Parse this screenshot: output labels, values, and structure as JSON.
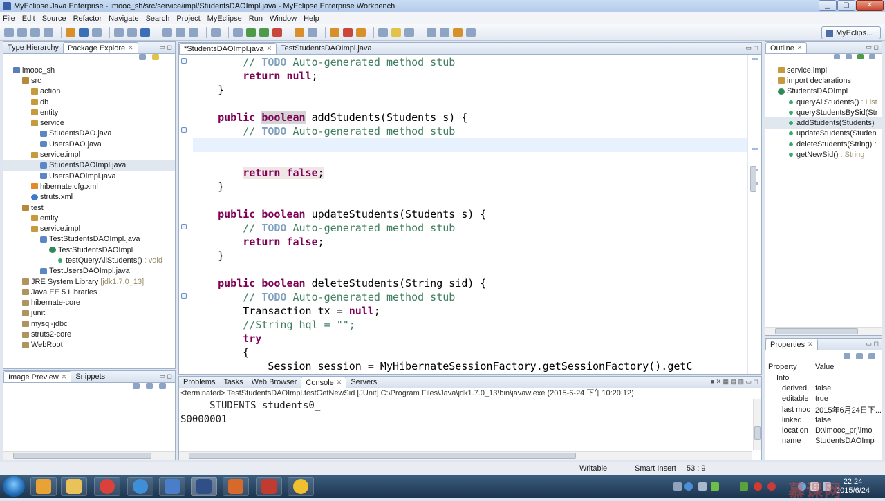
{
  "window": {
    "title": "MyEclipse Java Enterprise - imooc_sh/src/service/impl/StudentsDAOImpl.java - MyEclipse Enterprise Workbench"
  },
  "menu": [
    "File",
    "Edit",
    "Source",
    "Refactor",
    "Navigate",
    "Search",
    "Project",
    "MyEclipse",
    "Run",
    "Window",
    "Help"
  ],
  "perspective": "MyEclips...",
  "left_panel": {
    "tabs": [
      {
        "label": "Type Hierarchy"
      },
      {
        "label": "Package Explore"
      }
    ],
    "tree": [
      {
        "label": "imooc_sh",
        "icon": "project-icon",
        "depth": 0
      },
      {
        "label": "src",
        "icon": "source-folder-icon",
        "depth": 1
      },
      {
        "label": "action",
        "icon": "package-icon",
        "depth": 2
      },
      {
        "label": "db",
        "icon": "package-icon",
        "depth": 2
      },
      {
        "label": "entity",
        "icon": "package-icon",
        "depth": 2
      },
      {
        "label": "service",
        "icon": "package-icon",
        "depth": 2
      },
      {
        "label": "StudentsDAO.java",
        "icon": "java-file-icon",
        "depth": 3
      },
      {
        "label": "UsersDAO.java",
        "icon": "java-file-icon",
        "depth": 3
      },
      {
        "label": "service.impl",
        "icon": "package-icon",
        "depth": 2
      },
      {
        "label": "StudentsDAOImpl.java",
        "icon": "java-file-icon",
        "depth": 3,
        "selected": true
      },
      {
        "label": "UsersDAOImpl.java",
        "icon": "java-file-icon",
        "depth": 3
      },
      {
        "label": "hibernate.cfg.xml",
        "icon": "xml-file-icon",
        "depth": 2
      },
      {
        "label": "struts.xml",
        "icon": "config-icon",
        "depth": 2
      },
      {
        "label": "test",
        "icon": "source-folder-icon",
        "depth": 1
      },
      {
        "label": "entity",
        "icon": "package-icon",
        "depth": 2
      },
      {
        "label": "service.impl",
        "icon": "package-icon",
        "depth": 2
      },
      {
        "label": "TestStudentsDAOImpl.java",
        "icon": "java-file-icon",
        "depth": 3
      },
      {
        "label": "TestStudentsDAOImpl",
        "icon": "class-icon",
        "depth": 4
      },
      {
        "label": "testQueryAllStudents()",
        "sub": ": void",
        "icon": "method-icon",
        "depth": 5
      },
      {
        "label": "TestUsersDAOImpl.java",
        "icon": "java-file-icon",
        "depth": 3
      },
      {
        "label": "JRE System Library",
        "sub": "[jdk1.7.0_13]",
        "icon": "library-icon",
        "depth": 1
      },
      {
        "label": "Java EE 5 Libraries",
        "icon": "library-icon",
        "depth": 1
      },
      {
        "label": "hibernate-core",
        "icon": "library-icon",
        "depth": 1
      },
      {
        "label": "junit",
        "icon": "library-icon",
        "depth": 1
      },
      {
        "label": "mysql-jdbc",
        "icon": "library-icon",
        "depth": 1
      },
      {
        "label": "struts2-core",
        "icon": "library-icon",
        "depth": 1
      },
      {
        "label": "WebRoot",
        "icon": "folder-icon",
        "depth": 1
      }
    ]
  },
  "bottom_left": {
    "tabs": [
      {
        "label": "Image Preview"
      },
      {
        "label": "Snippets"
      }
    ]
  },
  "editor": {
    "tabs": [
      {
        "label": "*StudentsDAOImpl.java"
      },
      {
        "label": "TestStudentsDAOImpl.java"
      }
    ],
    "lines": [
      {
        "text": "        // TODO Auto-generated method stub",
        "type": "todo"
      },
      {
        "text": "        return null;",
        "type": "ret"
      },
      {
        "text": "    }",
        "type": "plain"
      },
      {
        "text": "",
        "type": "plain"
      },
      {
        "text": "    public boolean addStudents(Students s) {",
        "type": "sig"
      },
      {
        "text": "        // TODO Auto-generated method stub",
        "type": "todo"
      },
      {
        "text": "        ",
        "type": "cursor"
      },
      {
        "text": "",
        "type": "plain"
      },
      {
        "text": "        return false;",
        "type": "ret-hl"
      },
      {
        "text": "    }",
        "type": "plain"
      },
      {
        "text": "",
        "type": "plain"
      },
      {
        "text": "    public boolean updateStudents(Students s) {",
        "type": "sig"
      },
      {
        "text": "        // TODO Auto-generated method stub",
        "type": "todo"
      },
      {
        "text": "        return false;",
        "type": "ret"
      },
      {
        "text": "    }",
        "type": "plain"
      },
      {
        "text": "",
        "type": "plain"
      },
      {
        "text": "    public boolean deleteStudents(String sid) {",
        "type": "sig"
      },
      {
        "text": "        // TODO Auto-generated method stub",
        "type": "todo"
      },
      {
        "text": "        Transaction tx = null;",
        "type": "tx"
      },
      {
        "text": "        //String hql = \"\";",
        "type": "comment"
      },
      {
        "text": "        try",
        "type": "try"
      },
      {
        "text": "        {",
        "type": "plain"
      },
      {
        "text": "            Session session = MyHibernateSessionFactory.getSessionFactory().getC",
        "type": "sess"
      }
    ]
  },
  "outline": {
    "tab": "Outline",
    "items": [
      {
        "label": "service.impl",
        "depth": 0
      },
      {
        "label": "import declarations",
        "depth": 0
      },
      {
        "label": "StudentsDAOImpl",
        "depth": 0
      },
      {
        "label": "queryAllStudents()",
        "sub": ": List",
        "depth": 1
      },
      {
        "label": "queryStudentsBySid(Str",
        "depth": 1
      },
      {
        "label": "addStudents(Students)",
        "depth": 1,
        "selected": true
      },
      {
        "label": "updateStudents(Studen",
        "depth": 1
      },
      {
        "label": "deleteStudents(String) :",
        "depth": 1
      },
      {
        "label": "getNewSid()",
        "sub": ": String",
        "depth": 1
      }
    ]
  },
  "properties": {
    "tab": "Properties",
    "col_property": "Property",
    "col_value": "Value",
    "group": "Info",
    "rows": [
      {
        "k": "derived",
        "v": "false"
      },
      {
        "k": "editable",
        "v": "true"
      },
      {
        "k": "last moc",
        "v": "2015年6月24日下..."
      },
      {
        "k": "linked",
        "v": "false"
      },
      {
        "k": "location",
        "v": "D:\\imooc_prj\\imo"
      },
      {
        "k": "name",
        "v": "StudentsDAOImp"
      }
    ]
  },
  "console": {
    "tabs": [
      {
        "label": "Problems"
      },
      {
        "label": "Tasks"
      },
      {
        "label": "Web Browser"
      },
      {
        "label": "Console"
      },
      {
        "label": "Servers"
      }
    ],
    "header": "<terminated> TestStudentsDAOImpl.testGetNewSid [JUnit] C:\\Program Files\\Java\\jdk1.7.0_13\\bin\\javaw.exe (2015-6-24 下午10:20:12)",
    "lines": [
      "     STUDENTS students0_",
      "S0000001"
    ]
  },
  "status": {
    "writable": "Writable",
    "insert": "Smart Insert",
    "position": "53 : 9"
  },
  "taskbar": {
    "time": "22:24",
    "date": "2015/6/24"
  }
}
